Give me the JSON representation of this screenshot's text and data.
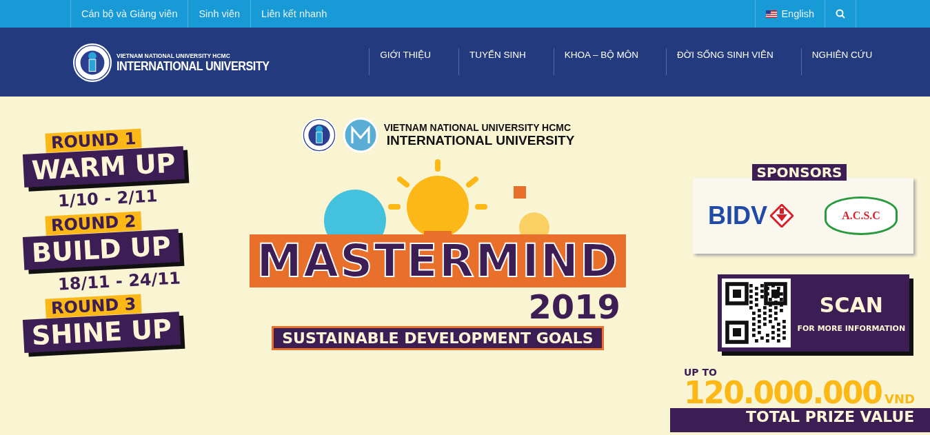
{
  "top_bar": {
    "links": [
      "Cán bộ và Giảng viên",
      "Sinh viên",
      "Liên kết nhanh"
    ],
    "language": "English"
  },
  "header": {
    "logo_line_1": "VIETNAM NATIONAL UNIVERSITY HCMC",
    "logo_line_2": "INTERNATIONAL UNIVERSITY",
    "nav": [
      "GIỚI THIỆU",
      "TUYỂN SINH",
      "KHOA – BỘ MÔN",
      "ĐỜI SỐNG SINH VIÊN",
      "NGHIÊN CỨU"
    ]
  },
  "banner": {
    "rounds": [
      {
        "label": "ROUND 1",
        "title": "WARM UP",
        "dates": "1/10 - 2/11"
      },
      {
        "label": "ROUND 2",
        "title": "BUILD UP",
        "dates": "18/11 - 24/11"
      },
      {
        "label": "ROUND 3",
        "title": "SHINE UP"
      }
    ],
    "org_line_1": "VIETNAM NATIONAL UNIVERSITY HCMC",
    "org_line_2": "INTERNATIONAL UNIVERSITY",
    "title": "MASTERMIND",
    "year": "2019",
    "theme": "SUSTAINABLE DEVELOPMENT GOALS",
    "sponsors_label": "SPONSORS",
    "sponsors": [
      "BIDV",
      "A.C.S.C"
    ],
    "scan_title": "SCAN",
    "scan_subtitle": "FOR MORE INFORMATION",
    "prize_prefix": "UP TO",
    "prize_amount": "120.000.000",
    "prize_currency": "VND",
    "prize_caption": "TOTAL PRIZE VALUE"
  }
}
